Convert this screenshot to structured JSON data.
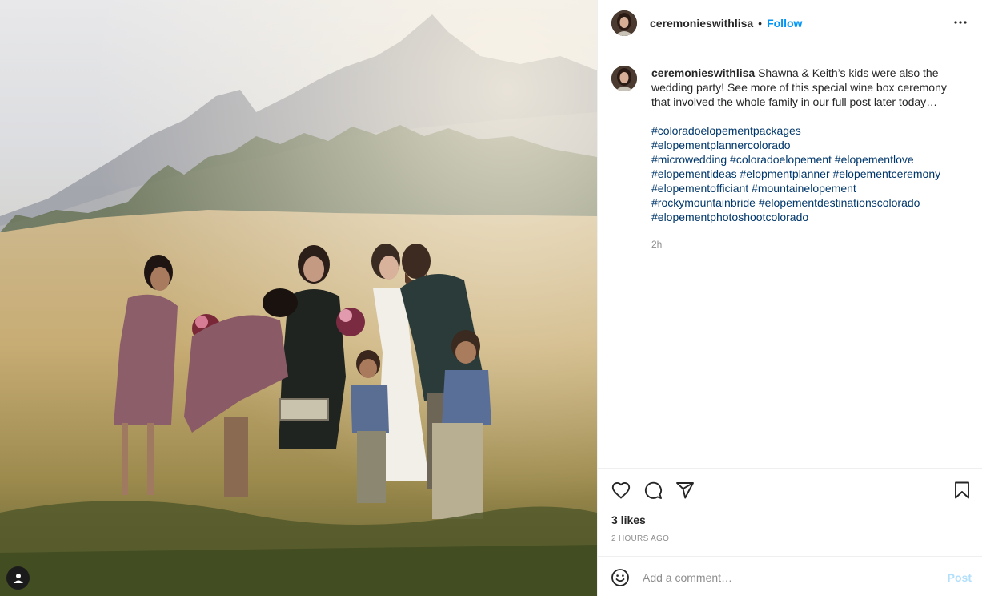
{
  "post": {
    "username": "ceremonieswithlisa",
    "follow_label": "Follow",
    "header_separator": "•",
    "more_icon": "more-horizontal-icon",
    "image_alt": "Wedding party of a couple, officiant, two girls in mauve dresses and two boys in plaid shirts in a golden meadow below the Flatirons mountains",
    "tag_icon": "user-tag-icon"
  },
  "caption": {
    "username": "ceremonieswithlisa",
    "text": "Shawna & Keith’s kids were also the wedding party! See more of this special wine box ceremony that involved the whole family in our full post later today…",
    "hashtags": [
      "#coloradoelopementpackages",
      "#elopementplannercolorado",
      "#microwedding #coloradoelopement #elopementlove",
      "#elopementideas #elopmentplanner #elopementceremony",
      "#elopementofficiant #mountainelopement",
      "#rockymountainbride #elopementdestinationscolorado",
      "#elopementphotoshootcolorado"
    ],
    "time": "2h"
  },
  "actions": {
    "like_icon": "heart-icon",
    "comment_icon": "comment-icon",
    "share_icon": "send-icon",
    "save_icon": "bookmark-icon",
    "likes_text": "3 likes",
    "posted_time": "2 HOURS AGO"
  },
  "comment_box": {
    "emoji_icon": "emoji-icon",
    "placeholder": "Add a comment…",
    "post_label": "Post"
  },
  "colors": {
    "accent": "#0095f6",
    "hashtag": "#00376b",
    "muted": "#8e8e8e",
    "post_disabled": "#b2dffc",
    "border": "#efefef"
  }
}
